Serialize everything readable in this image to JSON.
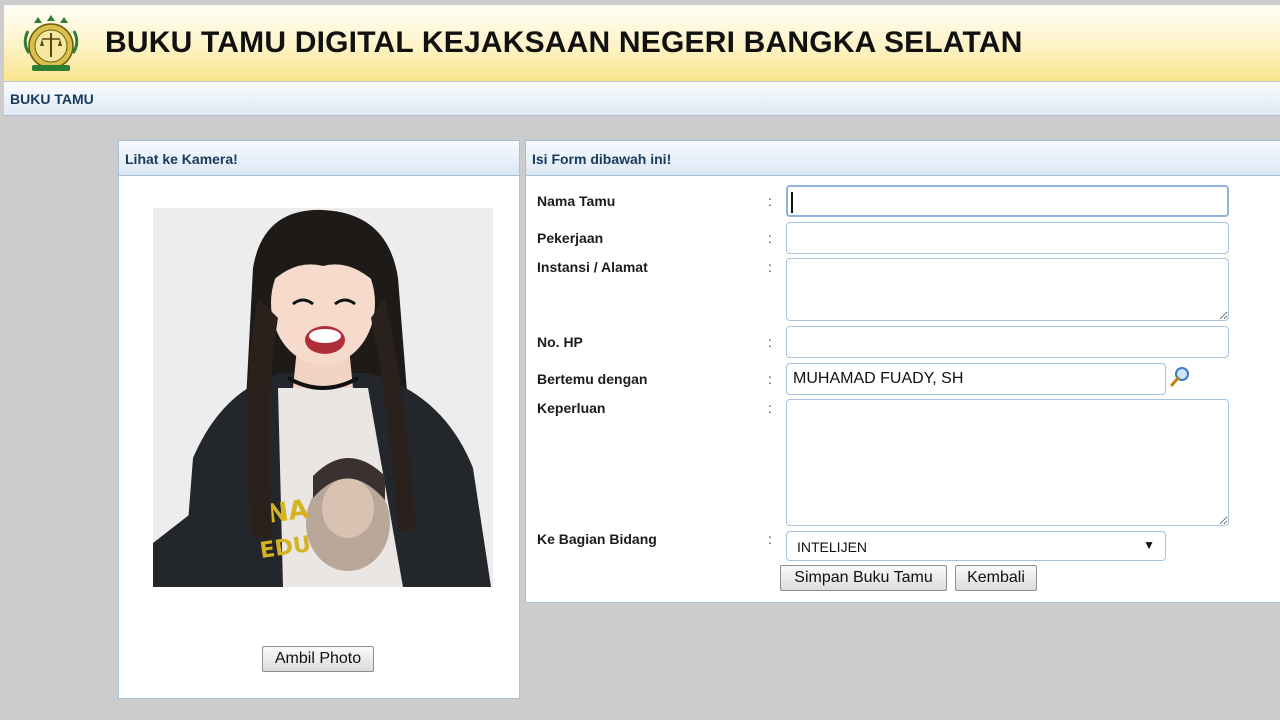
{
  "header": {
    "title": "BUKU TAMU DIGITAL KEJAKSAAN NEGERI BANGKA SELATAN",
    "logo_icon": "kejaksaan-emblem-icon"
  },
  "nav": {
    "item": "BUKU TAMU"
  },
  "camera_panel": {
    "title": "Lihat ke Kamera!",
    "capture_button": "Ambil Photo"
  },
  "form_panel": {
    "title": "Isi Form dibawah ini!",
    "fields": {
      "nama_tamu": {
        "label": "Nama Tamu",
        "value": ""
      },
      "pekerjaan": {
        "label": "Pekerjaan",
        "value": ""
      },
      "instansi": {
        "label": "Instansi / Alamat",
        "value": ""
      },
      "no_hp": {
        "label": "No. HP",
        "value": ""
      },
      "bertemu": {
        "label": "Bertemu dengan",
        "value": "MUHAMAD FUADY, SH"
      },
      "keperluan": {
        "label": "Keperluan",
        "value": ""
      },
      "bagian": {
        "label": "Ke Bagian Bidang",
        "value": "INTELIJEN"
      }
    },
    "colon": ":",
    "dropdown_arrow": "▼",
    "save_button": "Simpan Buku Tamu",
    "back_button": "Kembali"
  },
  "colors": {
    "panel_border": "#a7bfd9",
    "header_text": "#183a5c",
    "background": "#cccccc"
  }
}
